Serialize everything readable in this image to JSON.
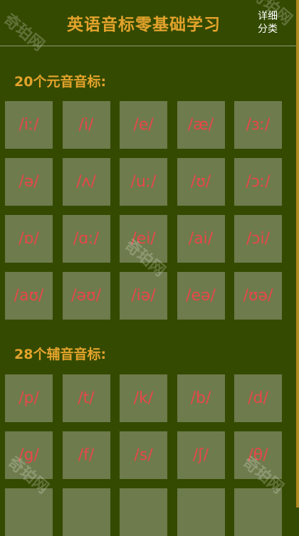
{
  "header": {
    "title": "英语音标零基础学习",
    "detail_button": "详细\n分类"
  },
  "vowels": {
    "title": "20个元音音标:",
    "items": [
      "/iː/",
      "/i/",
      "/e/",
      "/æ/",
      "/ɜː/",
      "/ə/",
      "/ʌ/",
      "/uː/",
      "/ʊ/",
      "/ɔː/",
      "/ɒ/",
      "/ɑː/",
      "/ei/",
      "/ai/",
      "/ɔi/",
      "/aʊ/",
      "/əʊ/",
      "/iə/",
      "/eə/",
      "/ʊə/"
    ]
  },
  "consonants": {
    "title": "28个辅音音标:",
    "items": [
      "/p/",
      "/t/",
      "/k/",
      "/b/",
      "/d/",
      "/g/",
      "/f/",
      "/s/",
      "/ʃ/",
      "/θ/",
      "",
      "",
      "",
      "",
      ""
    ]
  },
  "watermark": "奇珀网",
  "colors": {
    "background": "#344a00",
    "accent": "#e3a32c",
    "cell": "#6e7b4c",
    "symbol": "#e8474a"
  }
}
